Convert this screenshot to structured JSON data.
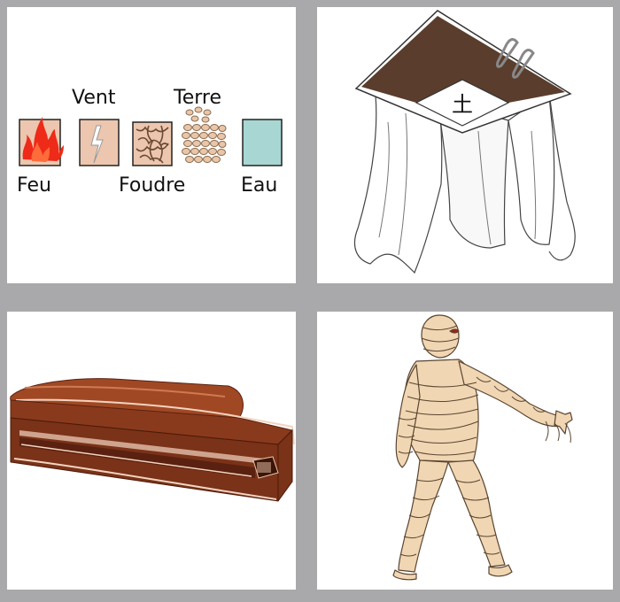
{
  "panels": {
    "elements": {
      "labels": {
        "feu": "Feu",
        "vent": "Vent",
        "foudre": "Foudre",
        "terre": "Terre",
        "eau": "Eau"
      },
      "icons": [
        "fire-icon",
        "lightning-icon",
        "crumpled-paper-icon",
        "pebbles-icon",
        "water-icon"
      ]
    },
    "shrine": {
      "roof_symbol": "土"
    },
    "coffin": {},
    "mummy": {}
  },
  "colors": {
    "fire": "#ee2a18",
    "wind_tile": "#ecc6ae",
    "earth": "#e9c6a8",
    "water": "#a8d6d3",
    "roof": "#5a3d2c",
    "coffin": "#8a3a1c",
    "bandage": "#f0d6b2"
  }
}
